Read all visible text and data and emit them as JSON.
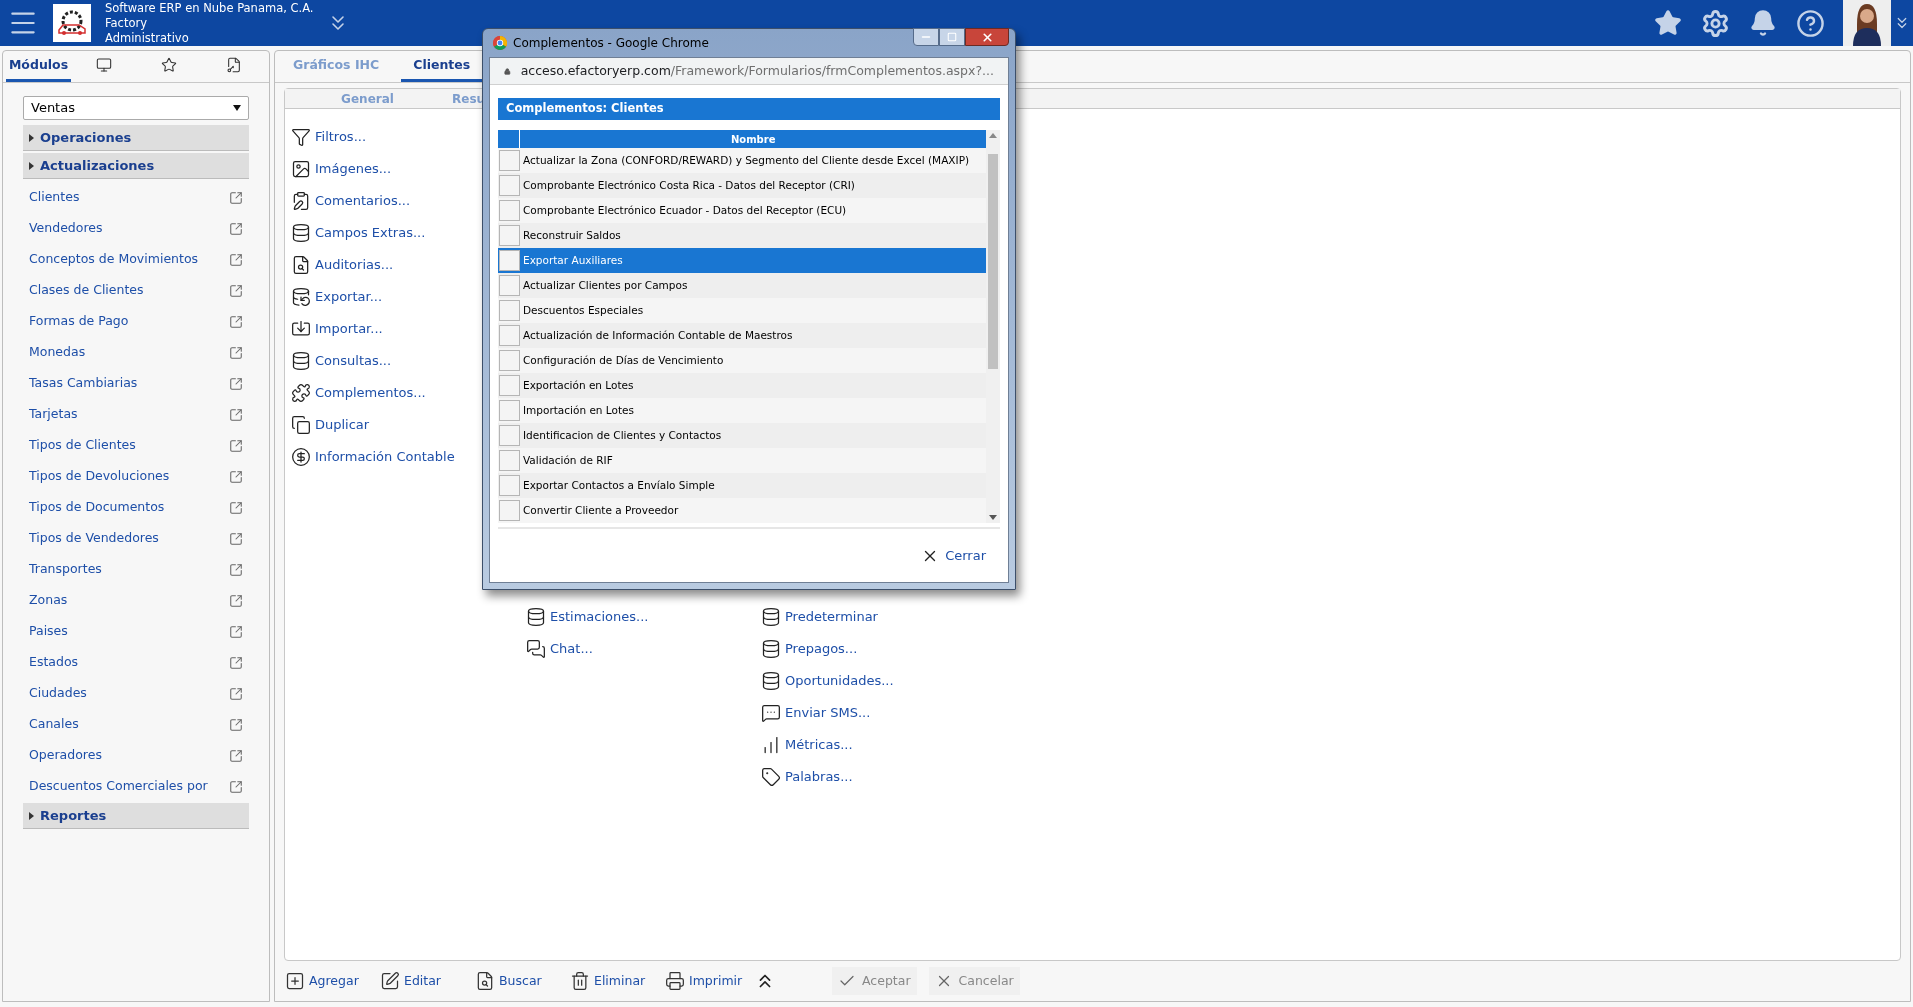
{
  "header": {
    "company": "Software ERP en Nube Panama, C.A.",
    "branch": "Factory",
    "role": "Administrativo"
  },
  "sidebar": {
    "tabs": [
      {
        "kind": "text",
        "label": "Módulos",
        "selected": true
      },
      {
        "kind": "monitor",
        "selected": false
      },
      {
        "kind": "star",
        "selected": false
      },
      {
        "kind": "key",
        "selected": false
      }
    ],
    "module_select": {
      "value": "Ventas"
    },
    "sections": [
      {
        "label": "Operaciones"
      },
      {
        "label": "Actualizaciones",
        "items": [
          "Clientes",
          "Vendedores",
          "Conceptos de Movimientos",
          "Clases de Clientes",
          "Formas de Pago",
          "Monedas",
          "Tasas Cambiarias",
          "Tarjetas",
          "Tipos de Clientes",
          "Tipos de Devoluciones",
          "Tipos de Documentos",
          "Tipos de Vendedores",
          "Transportes",
          "Zonas",
          "Paises",
          "Estados",
          "Ciudades",
          "Canales",
          "Operadores",
          "Descuentos Comerciales por"
        ]
      },
      {
        "label": "Reportes"
      }
    ]
  },
  "main": {
    "tabs": [
      {
        "label": "Gráficos IHC",
        "selected": false
      },
      {
        "label": "Clientes",
        "selected": true
      }
    ],
    "subtabs": [
      {
        "label": "General"
      },
      {
        "label": "Resu"
      }
    ],
    "actions": {
      "column_1": [
        "Filtros...",
        "Imágenes...",
        "Comentarios...",
        "Campos Extras...",
        "Auditorias...",
        "Exportar...",
        "Importar...",
        "Consultas...",
        "Complementos...",
        "Duplicar",
        "Información Contable"
      ],
      "column_2": [
        "Estimaciones...",
        "Chat..."
      ],
      "column_3": [
        "Predeterminar",
        "Prepagos...",
        "Oportunidades...",
        "Enviar SMS...",
        "Métricas...",
        "Palabras..."
      ]
    }
  },
  "toolbar": {
    "actions": [
      {
        "label": "Agregar",
        "disabled": false
      },
      {
        "label": "Editar",
        "disabled": false
      },
      {
        "label": "Buscar",
        "disabled": false
      },
      {
        "label": "Eliminar",
        "disabled": false
      },
      {
        "label": "Imprimir",
        "disabled": false
      }
    ],
    "confirm": [
      {
        "label": "Aceptar",
        "disabled": true
      },
      {
        "label": "Cancelar",
        "disabled": true
      }
    ]
  },
  "dialog": {
    "window_title": "Complementos - Google Chrome",
    "url_host": "acceso.efactoryerp.com",
    "url_path": "/Framework/Formularios/frmComplementos.aspx?...",
    "heading": "Complementos: Clientes",
    "table": {
      "columns": [
        "Nombre"
      ],
      "rows": [
        {
          "name": "Actualizar la Zona (CONFORD/REWARD) y Segmento del Cliente desde Excel (MAXIP)",
          "checked": false,
          "selected": false
        },
        {
          "name": "Comprobante Electrónico Costa Rica - Datos del Receptor (CRI)",
          "checked": false,
          "selected": false
        },
        {
          "name": "Comprobante Electrónico Ecuador - Datos del Receptor (ECU)",
          "checked": false,
          "selected": false
        },
        {
          "name": "Reconstruir Saldos",
          "checked": false,
          "selected": false
        },
        {
          "name": "Exportar Auxiliares",
          "checked": false,
          "selected": true
        },
        {
          "name": "Actualizar Clientes por Campos",
          "checked": false,
          "selected": false
        },
        {
          "name": "Descuentos Especiales",
          "checked": false,
          "selected": false
        },
        {
          "name": "Actualización de Información Contable de Maestros",
          "checked": false,
          "selected": false
        },
        {
          "name": "Configuración de Días de Vencimiento",
          "checked": false,
          "selected": false
        },
        {
          "name": "Exportación en Lotes",
          "checked": false,
          "selected": false
        },
        {
          "name": "Importación en Lotes",
          "checked": false,
          "selected": false
        },
        {
          "name": "Identificacion de Clientes y Contactos",
          "checked": false,
          "selected": false
        },
        {
          "name": "Validación de RIF",
          "checked": false,
          "selected": false
        },
        {
          "name": "Exportar Contactos a Envíalo Simple",
          "checked": false,
          "selected": false
        },
        {
          "name": "Convertir Cliente a Proveedor",
          "checked": false,
          "selected": false
        }
      ]
    },
    "close_button": "Cerrar"
  }
}
